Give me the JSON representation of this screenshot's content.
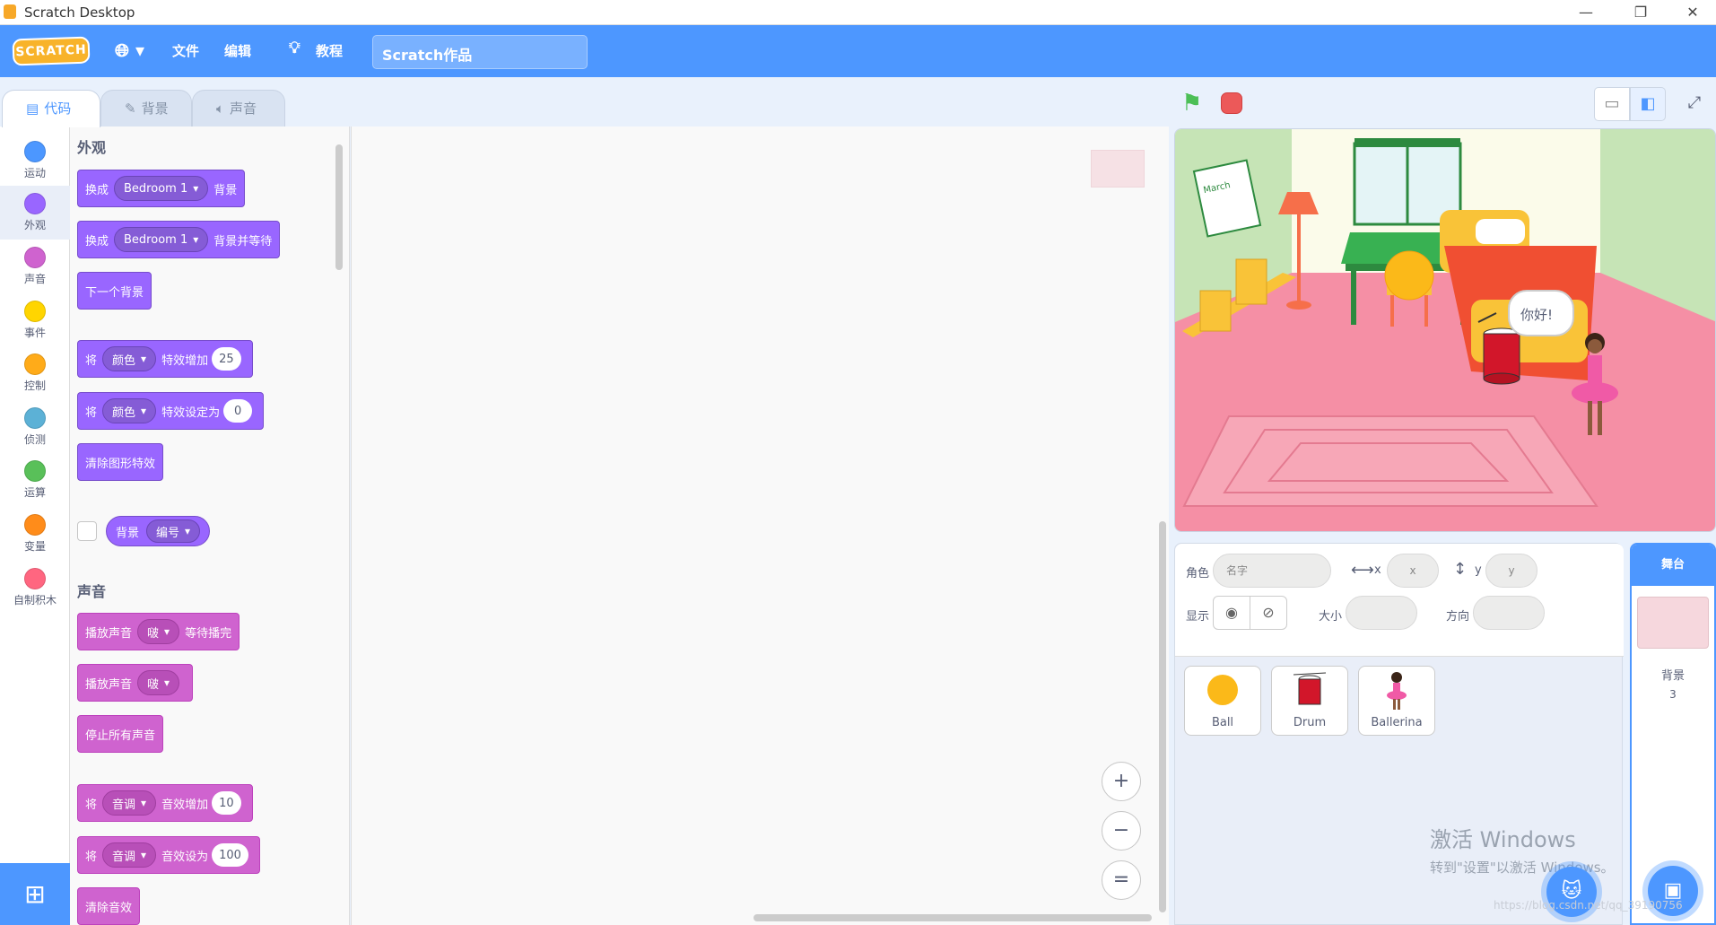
{
  "window": {
    "title": "Scratch Desktop",
    "controls": [
      "—",
      "❐",
      "✕"
    ]
  },
  "menubar": {
    "logo": "SCRATCH",
    "file": "文件",
    "edit": "编辑",
    "tutorials": "教程",
    "project_title": "Scratch作品"
  },
  "tabs": [
    {
      "label": "代码",
      "icon": "code-icon"
    },
    {
      "label": "背景",
      "icon": "brush-icon"
    },
    {
      "label": "声音",
      "icon": "speaker-icon"
    }
  ],
  "categories": [
    {
      "label": "运动",
      "color": "#4c97ff"
    },
    {
      "label": "外观",
      "color": "#9966ff"
    },
    {
      "label": "声音",
      "color": "#cf63cf"
    },
    {
      "label": "事件",
      "color": "#ffd500"
    },
    {
      "label": "控制",
      "color": "#ffab19"
    },
    {
      "label": "侦测",
      "color": "#5cb1d6"
    },
    {
      "label": "运算",
      "color": "#59c059"
    },
    {
      "label": "变量",
      "color": "#ff8c1a"
    },
    {
      "label": "自制积木",
      "color": "#ff6680"
    }
  ],
  "palette": {
    "looks_title": "外观",
    "sound_title": "声音",
    "looks": {
      "b1": {
        "a": "换成",
        "d": "Bedroom 1",
        "b": "背景"
      },
      "b2": {
        "a": "换成",
        "d": "Bedroom 1",
        "b": "背景并等待"
      },
      "b3": {
        "a": "下一个背景"
      },
      "b4": {
        "a": "将",
        "d": "颜色",
        "b": "特效增加",
        "n": "25"
      },
      "b5": {
        "a": "将",
        "d": "颜色",
        "b": "特效设定为",
        "n": "0"
      },
      "b6": {
        "a": "清除图形特效"
      },
      "r1": {
        "a": "背景",
        "d": "编号"
      }
    },
    "sound": {
      "b1": {
        "a": "播放声音",
        "d": "啵",
        "b": "等待播完"
      },
      "b2": {
        "a": "播放声音",
        "d": "啵"
      },
      "b3": {
        "a": "停止所有声音"
      },
      "b4": {
        "a": "将",
        "d": "音调",
        "b": "音效增加",
        "n": "10"
      },
      "b5": {
        "a": "将",
        "d": "音调",
        "b": "音效设为",
        "n": "100"
      },
      "b6": {
        "a": "清除音效"
      }
    }
  },
  "zoom": {
    "in": "+",
    "out": "−",
    "reset": "="
  },
  "stage": {
    "speech": "你好!",
    "calendar_text": "March"
  },
  "sprite_info": {
    "sprite_label": "角色",
    "name_placeholder": "名字",
    "x_label": "x",
    "x_placeholder": "x",
    "y_label": "y",
    "y_placeholder": "y",
    "show_label": "显示",
    "size_label": "大小",
    "direction_label": "方向"
  },
  "sprites": [
    {
      "name": "Ball"
    },
    {
      "name": "Drum"
    },
    {
      "name": "Ballerina"
    }
  ],
  "stage_pane": {
    "header": "舞台",
    "backdrops_label": "背景",
    "backdrops_count": "3"
  },
  "watermark": {
    "line1": "激活 Windows",
    "line2": "转到\"设置\"以激活 Windows。",
    "url": "https://blog.csdn.net/qq_39190756"
  }
}
